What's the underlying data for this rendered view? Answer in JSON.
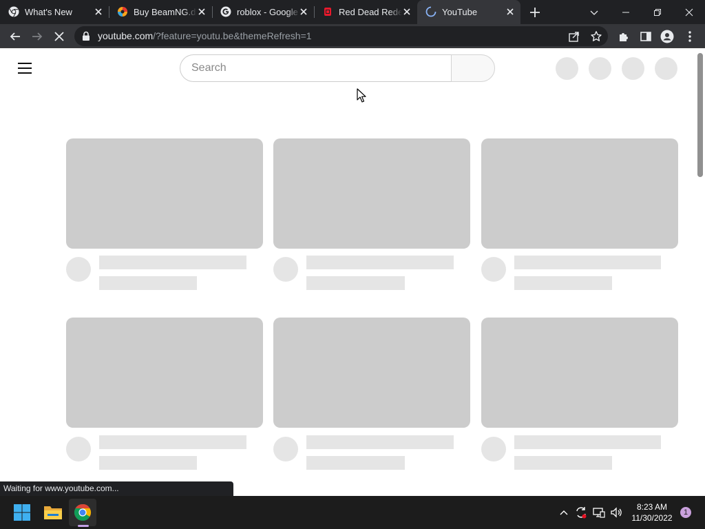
{
  "browser": {
    "tabs": [
      {
        "title": "What's New",
        "icon": "chrome-icon",
        "active": false
      },
      {
        "title": "Buy BeamNG.drive",
        "icon": "beamng-icon",
        "active": false
      },
      {
        "title": "roblox - Google Search",
        "icon": "google-icon",
        "active": false
      },
      {
        "title": "Red Dead Redemption",
        "icon": "rockstar-icon",
        "active": false
      },
      {
        "title": "YouTube",
        "icon": "loading-spinner-icon",
        "active": true
      }
    ],
    "url_host": "youtube.com",
    "url_path": "/?feature=youtu.be&themeRefresh=1",
    "status_text": "Waiting for www.youtube.com..."
  },
  "youtube": {
    "search_placeholder": "Search",
    "loading": true
  },
  "taskbar": {
    "apps": [
      "windows-start-icon",
      "file-explorer-icon",
      "chrome-icon"
    ],
    "time": "8:23 AM",
    "date": "11/30/2022",
    "notification_count": "1"
  },
  "colors": {
    "titlebar": "#202124",
    "toolbar": "#35363a",
    "placeholder_thumb": "#cccccc",
    "placeholder_light": "#e5e5e5",
    "taskbar": "#1c1c1c"
  }
}
